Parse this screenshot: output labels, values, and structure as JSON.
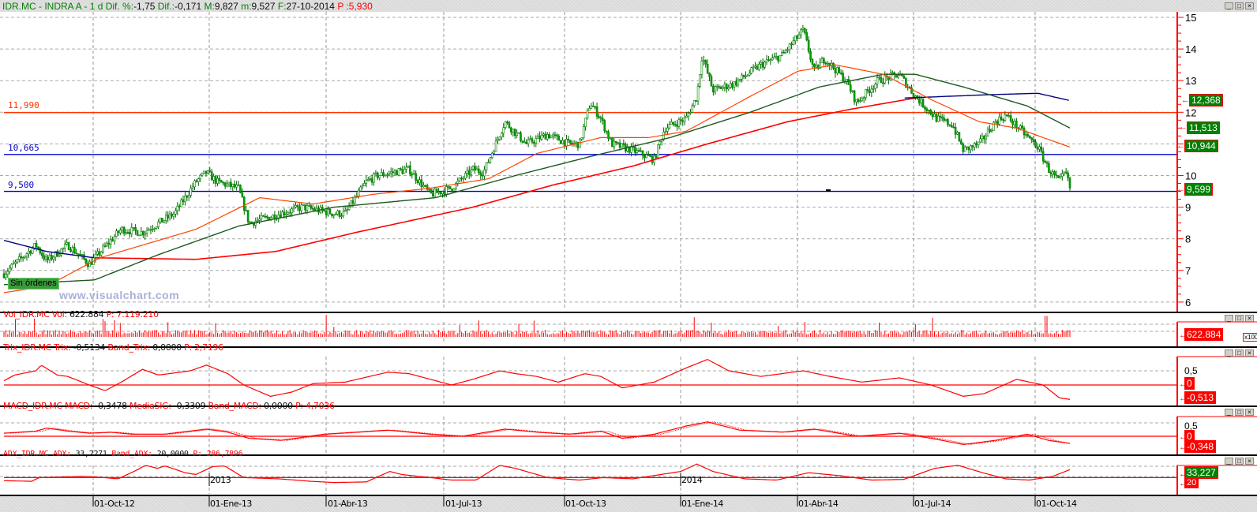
{
  "header": {
    "symbol": "IDR.MC - INDRA A -",
    "interval": "1 d",
    "dif_pct_label": "Dif. %:",
    "dif_pct": "-1,75",
    "dif_label": "Dif.:",
    "dif": "-0,171",
    "max_label": "M:",
    "max": "9,827",
    "min_label": "m:",
    "min": "9,527",
    "date_label": "F:",
    "date": "27-10-2014",
    "p_label": "P :",
    "p": "5,930"
  },
  "window_controls": {
    "minimize": "_",
    "maximize": "□",
    "close": "×"
  },
  "main": {
    "levels": [
      {
        "label": "11,990",
        "value": 11.99,
        "color": "#ff3300"
      },
      {
        "label": "10,665",
        "value": 10.665,
        "color": "#0000cc"
      },
      {
        "label": "9,500",
        "value": 9.5,
        "color": "#0000cc"
      }
    ],
    "axis_ticks": [
      "6",
      "7",
      "8",
      "9",
      "10",
      "11",
      "12",
      "13",
      "14",
      "15"
    ],
    "price_boxes": [
      {
        "label": "12,368",
        "value": 12.368
      },
      {
        "label": "11,513",
        "value": 11.513
      },
      {
        "label": "10,944",
        "value": 10.944
      },
      {
        "label": "9,599",
        "value": 9.599
      }
    ],
    "orders_label": "Sin órdenes",
    "watermark": "www.visualchart.com"
  },
  "volume": {
    "name": "Vol_IDR.MC",
    "field": "Vol:",
    "value": "622.884",
    "p_label": "P:",
    "p": "7.119.210",
    "axis_box": "622.884",
    "multiplier": "x100"
  },
  "trix": {
    "name": "Trix_IDR.MC",
    "field": "Trix:",
    "value": "-0,5134",
    "band_label": "Band_Trix:",
    "band": "0,0000",
    "p_label": "P:",
    "p": "2,7196",
    "ticks": [
      "0,5"
    ],
    "box_zero": "0",
    "box_value": "-0,513"
  },
  "macd": {
    "name": "MACD_IDR.MC",
    "field": "MACD:",
    "value": "-0,3478",
    "sig_label": "MediaSIG:",
    "sig": "-0,3309",
    "band_label": "Band_MACD:",
    "band": "0,0000",
    "p_label": "P:",
    "p": "4,7036",
    "ticks": [
      "0,5"
    ],
    "box_zero": "0",
    "box_value": "-0,348"
  },
  "adx": {
    "name": "ADX_IDR.MC",
    "field": "ADX:",
    "value": "33,2271",
    "band_label": "Band_ADX:",
    "band": "20,0000",
    "p_label": "P:",
    "p": "286,7896",
    "box_value": "33,227",
    "box_band": "20"
  },
  "date_axis": {
    "labels": [
      "01-Oct-12",
      "01-Ene-13",
      "01-Abr-13",
      "01-Jul-13",
      "01-Oct-13",
      "01-Ene-14",
      "01-Abr-14",
      "01-Jul-14",
      "01-Oct-14"
    ],
    "years": [
      "2013",
      "2014"
    ]
  },
  "chart_data": {
    "type": "line",
    "title": "IDR.MC - INDRA A - 1 d",
    "x_ticks": [
      "01-Oct-12",
      "01-Ene-13",
      "01-Abr-13",
      "01-Jul-13",
      "01-Oct-13",
      "01-Ene-14",
      "01-Abr-14",
      "01-Jul-14",
      "01-Oct-14"
    ],
    "ylim": [
      6,
      15
    ],
    "price_keypoints": [
      [
        0,
        6.9
      ],
      [
        0.03,
        7.8
      ],
      [
        0.04,
        7.3
      ],
      [
        0.06,
        7.8
      ],
      [
        0.08,
        7.2
      ],
      [
        0.11,
        8.3
      ],
      [
        0.13,
        8.2
      ],
      [
        0.16,
        8.8
      ],
      [
        0.18,
        9.8
      ],
      [
        0.19,
        10.1
      ],
      [
        0.2,
        9.8
      ],
      [
        0.22,
        9.6
      ],
      [
        0.23,
        8.5
      ],
      [
        0.26,
        8.8
      ],
      [
        0.28,
        9.0
      ],
      [
        0.31,
        8.8
      ],
      [
        0.32,
        8.8
      ],
      [
        0.34,
        9.8
      ],
      [
        0.35,
        10.0
      ],
      [
        0.38,
        10.2
      ],
      [
        0.4,
        9.4
      ],
      [
        0.42,
        9.6
      ],
      [
        0.44,
        10.2
      ],
      [
        0.45,
        10.1
      ],
      [
        0.47,
        11.7
      ],
      [
        0.49,
        11.0
      ],
      [
        0.51,
        11.3
      ],
      [
        0.53,
        11.0
      ],
      [
        0.54,
        11.0
      ],
      [
        0.55,
        12.3
      ],
      [
        0.56,
        11.8
      ],
      [
        0.57,
        11.0
      ],
      [
        0.59,
        10.8
      ],
      [
        0.61,
        10.5
      ],
      [
        0.62,
        11.5
      ],
      [
        0.64,
        11.8
      ],
      [
        0.65,
        12.5
      ],
      [
        0.655,
        13.8
      ],
      [
        0.665,
        12.7
      ],
      [
        0.685,
        12.9
      ],
      [
        0.71,
        13.5
      ],
      [
        0.73,
        13.8
      ],
      [
        0.75,
        14.6
      ],
      [
        0.76,
        13.3
      ],
      [
        0.77,
        13.7
      ],
      [
        0.79,
        13.0
      ],
      [
        0.8,
        12.3
      ],
      [
        0.82,
        13.0
      ],
      [
        0.84,
        13.2
      ],
      [
        0.855,
        12.5
      ],
      [
        0.875,
        11.8
      ],
      [
        0.89,
        11.6
      ],
      [
        0.9,
        10.8
      ],
      [
        0.915,
        11.0
      ],
      [
        0.93,
        11.7
      ],
      [
        0.94,
        11.9
      ],
      [
        0.955,
        11.4
      ],
      [
        0.97,
        10.9
      ],
      [
        0.98,
        10.2
      ],
      [
        0.99,
        9.8
      ],
      [
        0.996,
        10.1
      ],
      [
        1,
        9.6
      ]
    ],
    "ma_short": [
      [
        0,
        6.3
      ],
      [
        0.04,
        6.5
      ],
      [
        0.09,
        7.4
      ],
      [
        0.18,
        8.3
      ],
      [
        0.24,
        9.3
      ],
      [
        0.29,
        9.1
      ],
      [
        0.345,
        9.4
      ],
      [
        0.4,
        9.6
      ],
      [
        0.455,
        9.9
      ],
      [
        0.5,
        10.7
      ],
      [
        0.56,
        11.2
      ],
      [
        0.605,
        11.2
      ],
      [
        0.64,
        11.4
      ],
      [
        0.7,
        12.5
      ],
      [
        0.745,
        13.3
      ],
      [
        0.78,
        13.5
      ],
      [
        0.825,
        13.2
      ],
      [
        0.87,
        12.4
      ],
      [
        0.915,
        11.7
      ],
      [
        0.95,
        11.5
      ],
      [
        1,
        10.9
      ]
    ],
    "ma_medium": [
      [
        0,
        6.55
      ],
      [
        0.085,
        6.7
      ],
      [
        0.145,
        7.5
      ],
      [
        0.22,
        8.4
      ],
      [
        0.31,
        9.0
      ],
      [
        0.405,
        9.3
      ],
      [
        0.48,
        10.0
      ],
      [
        0.55,
        10.6
      ],
      [
        0.625,
        11.2
      ],
      [
        0.7,
        12.0
      ],
      [
        0.765,
        12.8
      ],
      [
        0.825,
        13.2
      ],
      [
        0.855,
        13.2
      ],
      [
        0.9,
        12.8
      ],
      [
        0.96,
        12.2
      ],
      [
        1,
        11.5
      ]
    ],
    "ma_long_red": [
      [
        0.085,
        7.4
      ],
      [
        0.18,
        7.35
      ],
      [
        0.255,
        7.6
      ],
      [
        0.33,
        8.2
      ],
      [
        0.44,
        9.0
      ],
      [
        0.515,
        9.7
      ],
      [
        0.59,
        10.3
      ],
      [
        0.66,
        11.0
      ],
      [
        0.735,
        11.7
      ],
      [
        0.795,
        12.1
      ],
      [
        0.855,
        12.45
      ]
    ],
    "ma_long_blue_start": [
      [
        0,
        7.95
      ],
      [
        0.04,
        7.6
      ],
      [
        0.085,
        7.4
      ]
    ],
    "ma_long_blue_end": [
      [
        0.845,
        12.45
      ],
      [
        0.92,
        12.55
      ],
      [
        0.97,
        12.6
      ],
      [
        1,
        12.37
      ]
    ],
    "trix": [
      [
        0,
        0.15
      ],
      [
        0.01,
        0.35
      ],
      [
        0.03,
        0.5
      ],
      [
        0.035,
        0.7
      ],
      [
        0.05,
        0.35
      ],
      [
        0.06,
        0.3
      ],
      [
        0.08,
        0
      ],
      [
        0.095,
        -0.2
      ],
      [
        0.11,
        0.1
      ],
      [
        0.13,
        0.55
      ],
      [
        0.145,
        0.35
      ],
      [
        0.175,
        0.5
      ],
      [
        0.19,
        0.7
      ],
      [
        0.21,
        0.4
      ],
      [
        0.225,
        0
      ],
      [
        0.25,
        -0.4
      ],
      [
        0.27,
        -0.25
      ],
      [
        0.29,
        0.05
      ],
      [
        0.32,
        0.1
      ],
      [
        0.36,
        0.45
      ],
      [
        0.38,
        0.4
      ],
      [
        0.4,
        0.2
      ],
      [
        0.42,
        0
      ],
      [
        0.44,
        0.2
      ],
      [
        0.465,
        0.5
      ],
      [
        0.48,
        0.4
      ],
      [
        0.5,
        0.3
      ],
      [
        0.52,
        0.1
      ],
      [
        0.545,
        0.4
      ],
      [
        0.56,
        0.3
      ],
      [
        0.58,
        -0.1
      ],
      [
        0.61,
        0.1
      ],
      [
        0.64,
        0.6
      ],
      [
        0.66,
        0.9
      ],
      [
        0.68,
        0.5
      ],
      [
        0.71,
        0.3
      ],
      [
        0.73,
        0.4
      ],
      [
        0.75,
        0.5
      ],
      [
        0.775,
        0.3
      ],
      [
        0.805,
        0.1
      ],
      [
        0.84,
        0.25
      ],
      [
        0.87,
        0
      ],
      [
        0.9,
        -0.4
      ],
      [
        0.92,
        -0.3
      ],
      [
        0.95,
        0.2
      ],
      [
        0.975,
        0
      ],
      [
        0.99,
        -0.45
      ],
      [
        1,
        -0.51
      ]
    ],
    "macd": [
      [
        0,
        0.15
      ],
      [
        0.03,
        0.25
      ],
      [
        0.04,
        0.4
      ],
      [
        0.06,
        0.25
      ],
      [
        0.08,
        0.15
      ],
      [
        0.1,
        0.2
      ],
      [
        0.12,
        0.1
      ],
      [
        0.15,
        0.1
      ],
      [
        0.19,
        0.35
      ],
      [
        0.21,
        0.2
      ],
      [
        0.23,
        -0.1
      ],
      [
        0.26,
        -0.2
      ],
      [
        0.3,
        0.1
      ],
      [
        0.36,
        0.3
      ],
      [
        0.4,
        0.1
      ],
      [
        0.43,
        0.0
      ],
      [
        0.47,
        0.35
      ],
      [
        0.5,
        0.2
      ],
      [
        0.53,
        0.1
      ],
      [
        0.56,
        0.25
      ],
      [
        0.58,
        -0.1
      ],
      [
        0.61,
        0.1
      ],
      [
        0.64,
        0.5
      ],
      [
        0.66,
        0.7
      ],
      [
        0.69,
        0.3
      ],
      [
        0.73,
        0.2
      ],
      [
        0.76,
        0.35
      ],
      [
        0.8,
        0.0
      ],
      [
        0.84,
        0.15
      ],
      [
        0.87,
        -0.1
      ],
      [
        0.9,
        -0.4
      ],
      [
        0.93,
        -0.2
      ],
      [
        0.96,
        0.1
      ],
      [
        0.98,
        -0.2
      ],
      [
        1,
        -0.35
      ]
    ],
    "adx": [
      [
        0,
        15
      ],
      [
        0.026,
        14
      ],
      [
        0.033,
        20
      ],
      [
        0.074,
        22
      ],
      [
        0.087,
        21
      ],
      [
        0.107,
        18
      ],
      [
        0.122,
        30
      ],
      [
        0.133,
        40
      ],
      [
        0.144,
        35
      ],
      [
        0.151,
        39
      ],
      [
        0.17,
        28
      ],
      [
        0.18,
        25
      ],
      [
        0.196,
        38
      ],
      [
        0.207,
        39
      ],
      [
        0.225,
        20
      ],
      [
        0.258,
        18
      ],
      [
        0.288,
        14
      ],
      [
        0.31,
        12
      ],
      [
        0.34,
        13
      ],
      [
        0.362,
        30
      ],
      [
        0.373,
        25
      ],
      [
        0.4,
        20
      ],
      [
        0.42,
        16
      ],
      [
        0.443,
        16
      ],
      [
        0.465,
        40
      ],
      [
        0.48,
        35
      ],
      [
        0.51,
        20
      ],
      [
        0.54,
        16
      ],
      [
        0.562,
        20
      ],
      [
        0.59,
        18
      ],
      [
        0.635,
        30
      ],
      [
        0.65,
        42
      ],
      [
        0.665,
        30
      ],
      [
        0.695,
        18
      ],
      [
        0.725,
        16
      ],
      [
        0.755,
        28
      ],
      [
        0.785,
        23
      ],
      [
        0.814,
        16
      ],
      [
        0.844,
        17
      ],
      [
        0.873,
        35
      ],
      [
        0.895,
        40
      ],
      [
        0.918,
        28
      ],
      [
        0.94,
        18
      ],
      [
        0.962,
        16
      ],
      [
        0.984,
        22
      ],
      [
        1,
        33
      ]
    ],
    "adx_band": 20
  }
}
